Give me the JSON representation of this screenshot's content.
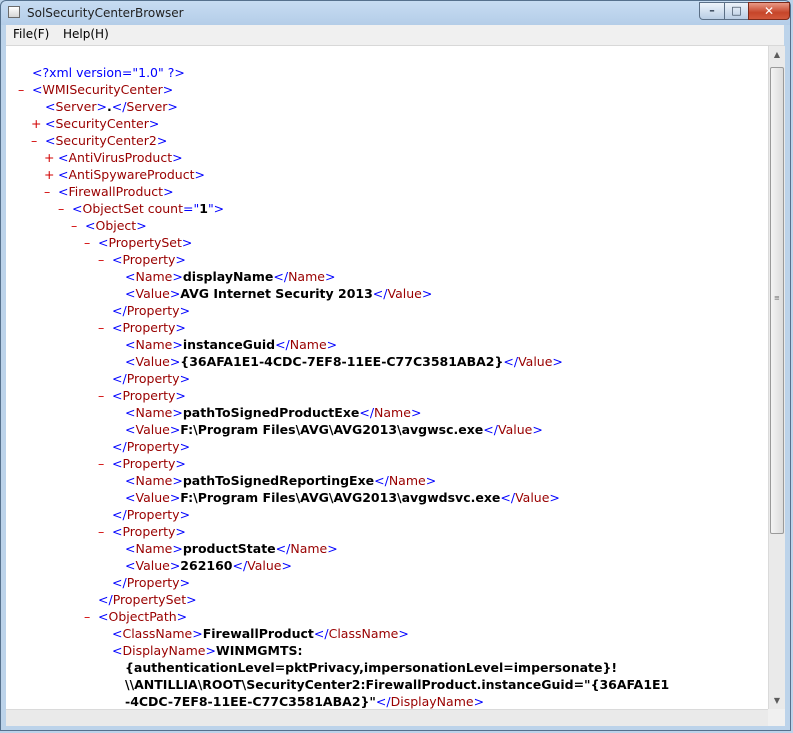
{
  "window": {
    "title": "SolSecurityCenterBrowser"
  },
  "controls": {
    "minimize": "–",
    "maximize": "□",
    "close": "✕"
  },
  "menu": {
    "file": "File(F)",
    "help": "Help(H)"
  },
  "icons": {
    "app": "app-icon",
    "scroll_up": "chevron-up-icon",
    "scroll_down": "chevron-down-icon",
    "grip": "grip-icon"
  },
  "xml": {
    "declaration": "<?xml version=\"1.0\" ?>",
    "t_wmi": "WMISecurityCenter",
    "t_server": "Server",
    "v_server": ".",
    "t_sc": "SecurityCenter",
    "t_sc2": "SecurityCenter2",
    "t_av": "AntiVirusProduct",
    "t_as": "AntiSpywareProduct",
    "t_fw": "FirewallProduct",
    "t_objset": "ObjectSet",
    "a_count": "count",
    "v_count": "1",
    "t_object": "Object",
    "t_propset": "PropertySet",
    "t_prop": "Property",
    "t_name": "Name",
    "t_value": "Value",
    "t_objpath": "ObjectPath",
    "t_classname": "ClassName",
    "t_displayname": "DisplayName",
    "p1_name": "displayName",
    "p1_value": "AVG Internet Security 2013",
    "p2_name": "instanceGuid",
    "p2_value": "{36AFA1E1-4CDC-7EF8-11EE-C77C3581ABA2}",
    "p3_name": "pathToSignedProductExe",
    "p3_value": "F:\\Program Files\\AVG\\AVG2013\\avgwsc.exe",
    "p4_name": "pathToSignedReportingExe",
    "p4_value": "F:\\Program Files\\AVG\\AVG2013\\avgwdsvc.exe",
    "p5_name": "productState",
    "p5_value": "262160",
    "class_value": "FirewallProduct",
    "disp_line1": "WINMGMTS:",
    "disp_line2": "{authenticationLevel=pktPrivacy,impersonationLevel=impersonate}!",
    "disp_line3": "\\\\ANTILLIA\\ROOT\\SecurityCenter2:FirewallProduct.instanceGuid=\"{36AFA1E1",
    "disp_line4": "-4CDC-7EF8-11EE-C77C3581ABA2}\"",
    "minus": "–",
    "plus": "+"
  }
}
